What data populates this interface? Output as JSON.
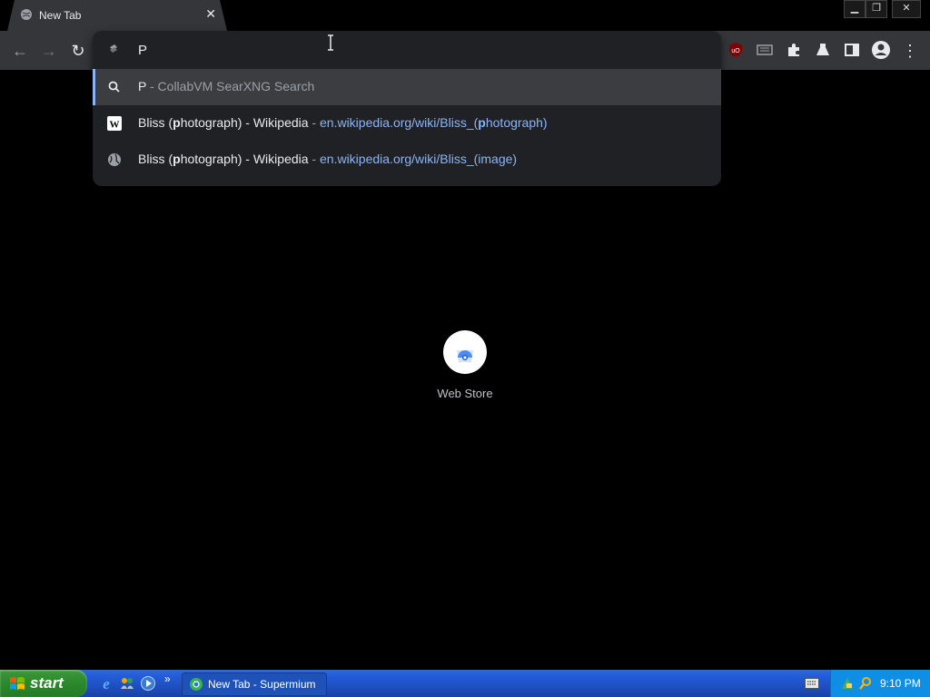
{
  "tab": {
    "title": "New Tab"
  },
  "omnibox": {
    "input_value": "P",
    "suggestions": [
      {
        "query": "P",
        "separator": " - ",
        "engine": "CollabVM SearXNG Search",
        "icon": "search-icon"
      },
      {
        "title_pre": "Bliss (",
        "title_match": "p",
        "title_post": "hotograph) - Wikipedia",
        "separator": " - ",
        "url_pre": "en.wikipedia.org/wiki/Bliss_(",
        "url_match": "p",
        "url_post": "hotograph)",
        "icon": "wikipedia-icon"
      },
      {
        "title_pre": "Bliss (",
        "title_match": "p",
        "title_post": "hotograph) - Wikipedia",
        "separator": " - ",
        "url": "en.wikipedia.org/wiki/Bliss_(image)",
        "icon": "globe-icon"
      }
    ]
  },
  "shortcut": {
    "label": "Web Store"
  },
  "taskbar": {
    "start_label": "start",
    "window_title": "New Tab - Supermium",
    "chevron": "»",
    "clock": "9:10 PM"
  },
  "colors": {
    "accent": "#8ab4f8",
    "toolbar": "#35363a",
    "popup": "#202124"
  }
}
